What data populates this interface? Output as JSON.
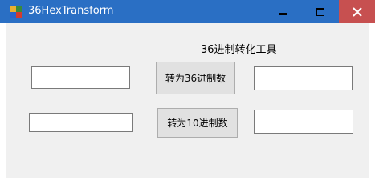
{
  "window": {
    "title": "36HexTransform",
    "accent_color": "#2a6fc4",
    "close_color": "#c75050"
  },
  "form": {
    "caption": "36进制转化工具",
    "to36_button_label": "转为36进制数",
    "to10_button_label": "转为10进制数",
    "input_top_left": "",
    "input_top_right": "",
    "input_bottom_left": "",
    "input_bottom_right": ""
  }
}
